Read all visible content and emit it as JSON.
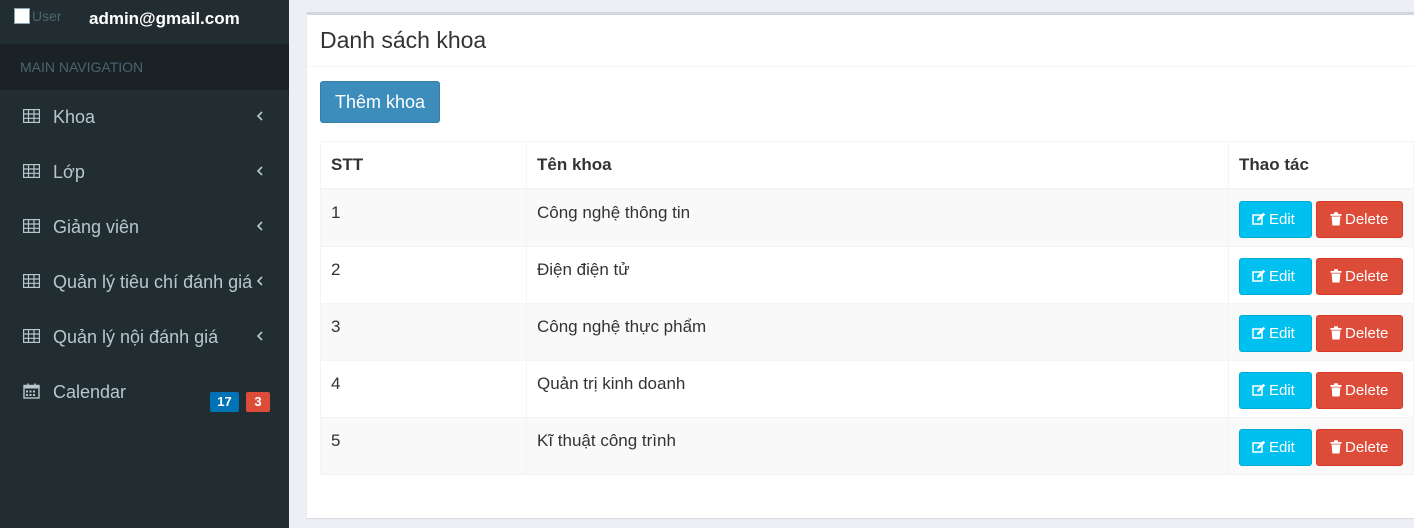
{
  "sidebar": {
    "user": {
      "image_alt": "User Image",
      "email": "admin@gmail.com"
    },
    "nav_header": "MAIN NAVIGATION",
    "items": [
      {
        "label": "Khoa",
        "icon": "table-icon",
        "expandable": true
      },
      {
        "label": "Lớp",
        "icon": "table-icon",
        "expandable": true
      },
      {
        "label": "Giảng viên",
        "icon": "table-icon",
        "expandable": true
      },
      {
        "label": "Quản lý tiêu chí đánh giá",
        "icon": "table-icon",
        "expandable": true
      },
      {
        "label": "Quản lý nội đánh giá",
        "icon": "table-icon",
        "expandable": true
      },
      {
        "label": "Calendar",
        "icon": "calendar-icon",
        "badges": [
          "17",
          "3"
        ]
      }
    ]
  },
  "main": {
    "title": "Danh sách khoa",
    "add_button": "Thêm khoa",
    "table": {
      "columns": [
        "STT",
        "Tên khoa",
        "Thao tác"
      ],
      "rows": [
        {
          "stt": "1",
          "name": "Công nghệ thông tin"
        },
        {
          "stt": "2",
          "name": "Điện điện tử"
        },
        {
          "stt": "3",
          "name": "Công nghệ thực phẩm"
        },
        {
          "stt": "4",
          "name": "Quản trị kinh doanh"
        },
        {
          "stt": "5",
          "name": "Kĩ thuật công trình"
        }
      ],
      "edit_label": "Edit",
      "delete_label": "Delete"
    }
  },
  "colors": {
    "sidebar_bg": "#222d32",
    "primary": "#3c8dbc",
    "info": "#00c0ef",
    "danger": "#dd4b39",
    "badge_blue": "#0073b7"
  }
}
